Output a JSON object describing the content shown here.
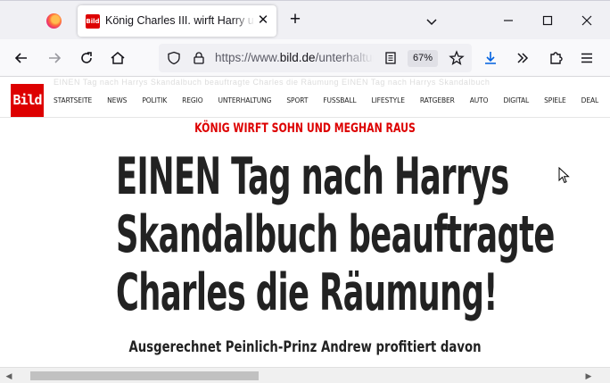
{
  "browser": {
    "tab": {
      "favicon": "Bild",
      "title": "König Charles III. wirft Harry und Meghan raus",
      "close_label": "✕"
    },
    "new_tab_label": "+",
    "url": {
      "prefix": "https://www.",
      "domain": "bild.de",
      "rest": "/unterhaltung"
    },
    "zoom": "67%"
  },
  "site": {
    "logo": "Bild",
    "ghost_text": "EINEN Tag nach Harrys Skandalbuch beauftragte Charles die Räumung EINEN Tag nach Harrys Skandalbuch",
    "menu": [
      "STARTSEITE",
      "NEWS",
      "POLITIK",
      "REGIO",
      "UNTERHALTUNG",
      "SPORT",
      "FUSSBALL",
      "LIFESTYLE",
      "RATGEBER",
      "AUTO",
      "DIGITAL",
      "SPIELE",
      "DEAL"
    ]
  },
  "article": {
    "kicker": "KÖNIG WIRFT SOHN UND MEGHAN RAUS",
    "headline": [
      "EINEN Tag nach Harrys",
      "Skandalbuch beauftragte",
      "Charles die Räumung!"
    ],
    "subline": "Ausgerechnet Peinlich-Prinz Andrew profitiert davon"
  },
  "colors": {
    "brand": "#dd0000",
    "text": "#222222"
  }
}
